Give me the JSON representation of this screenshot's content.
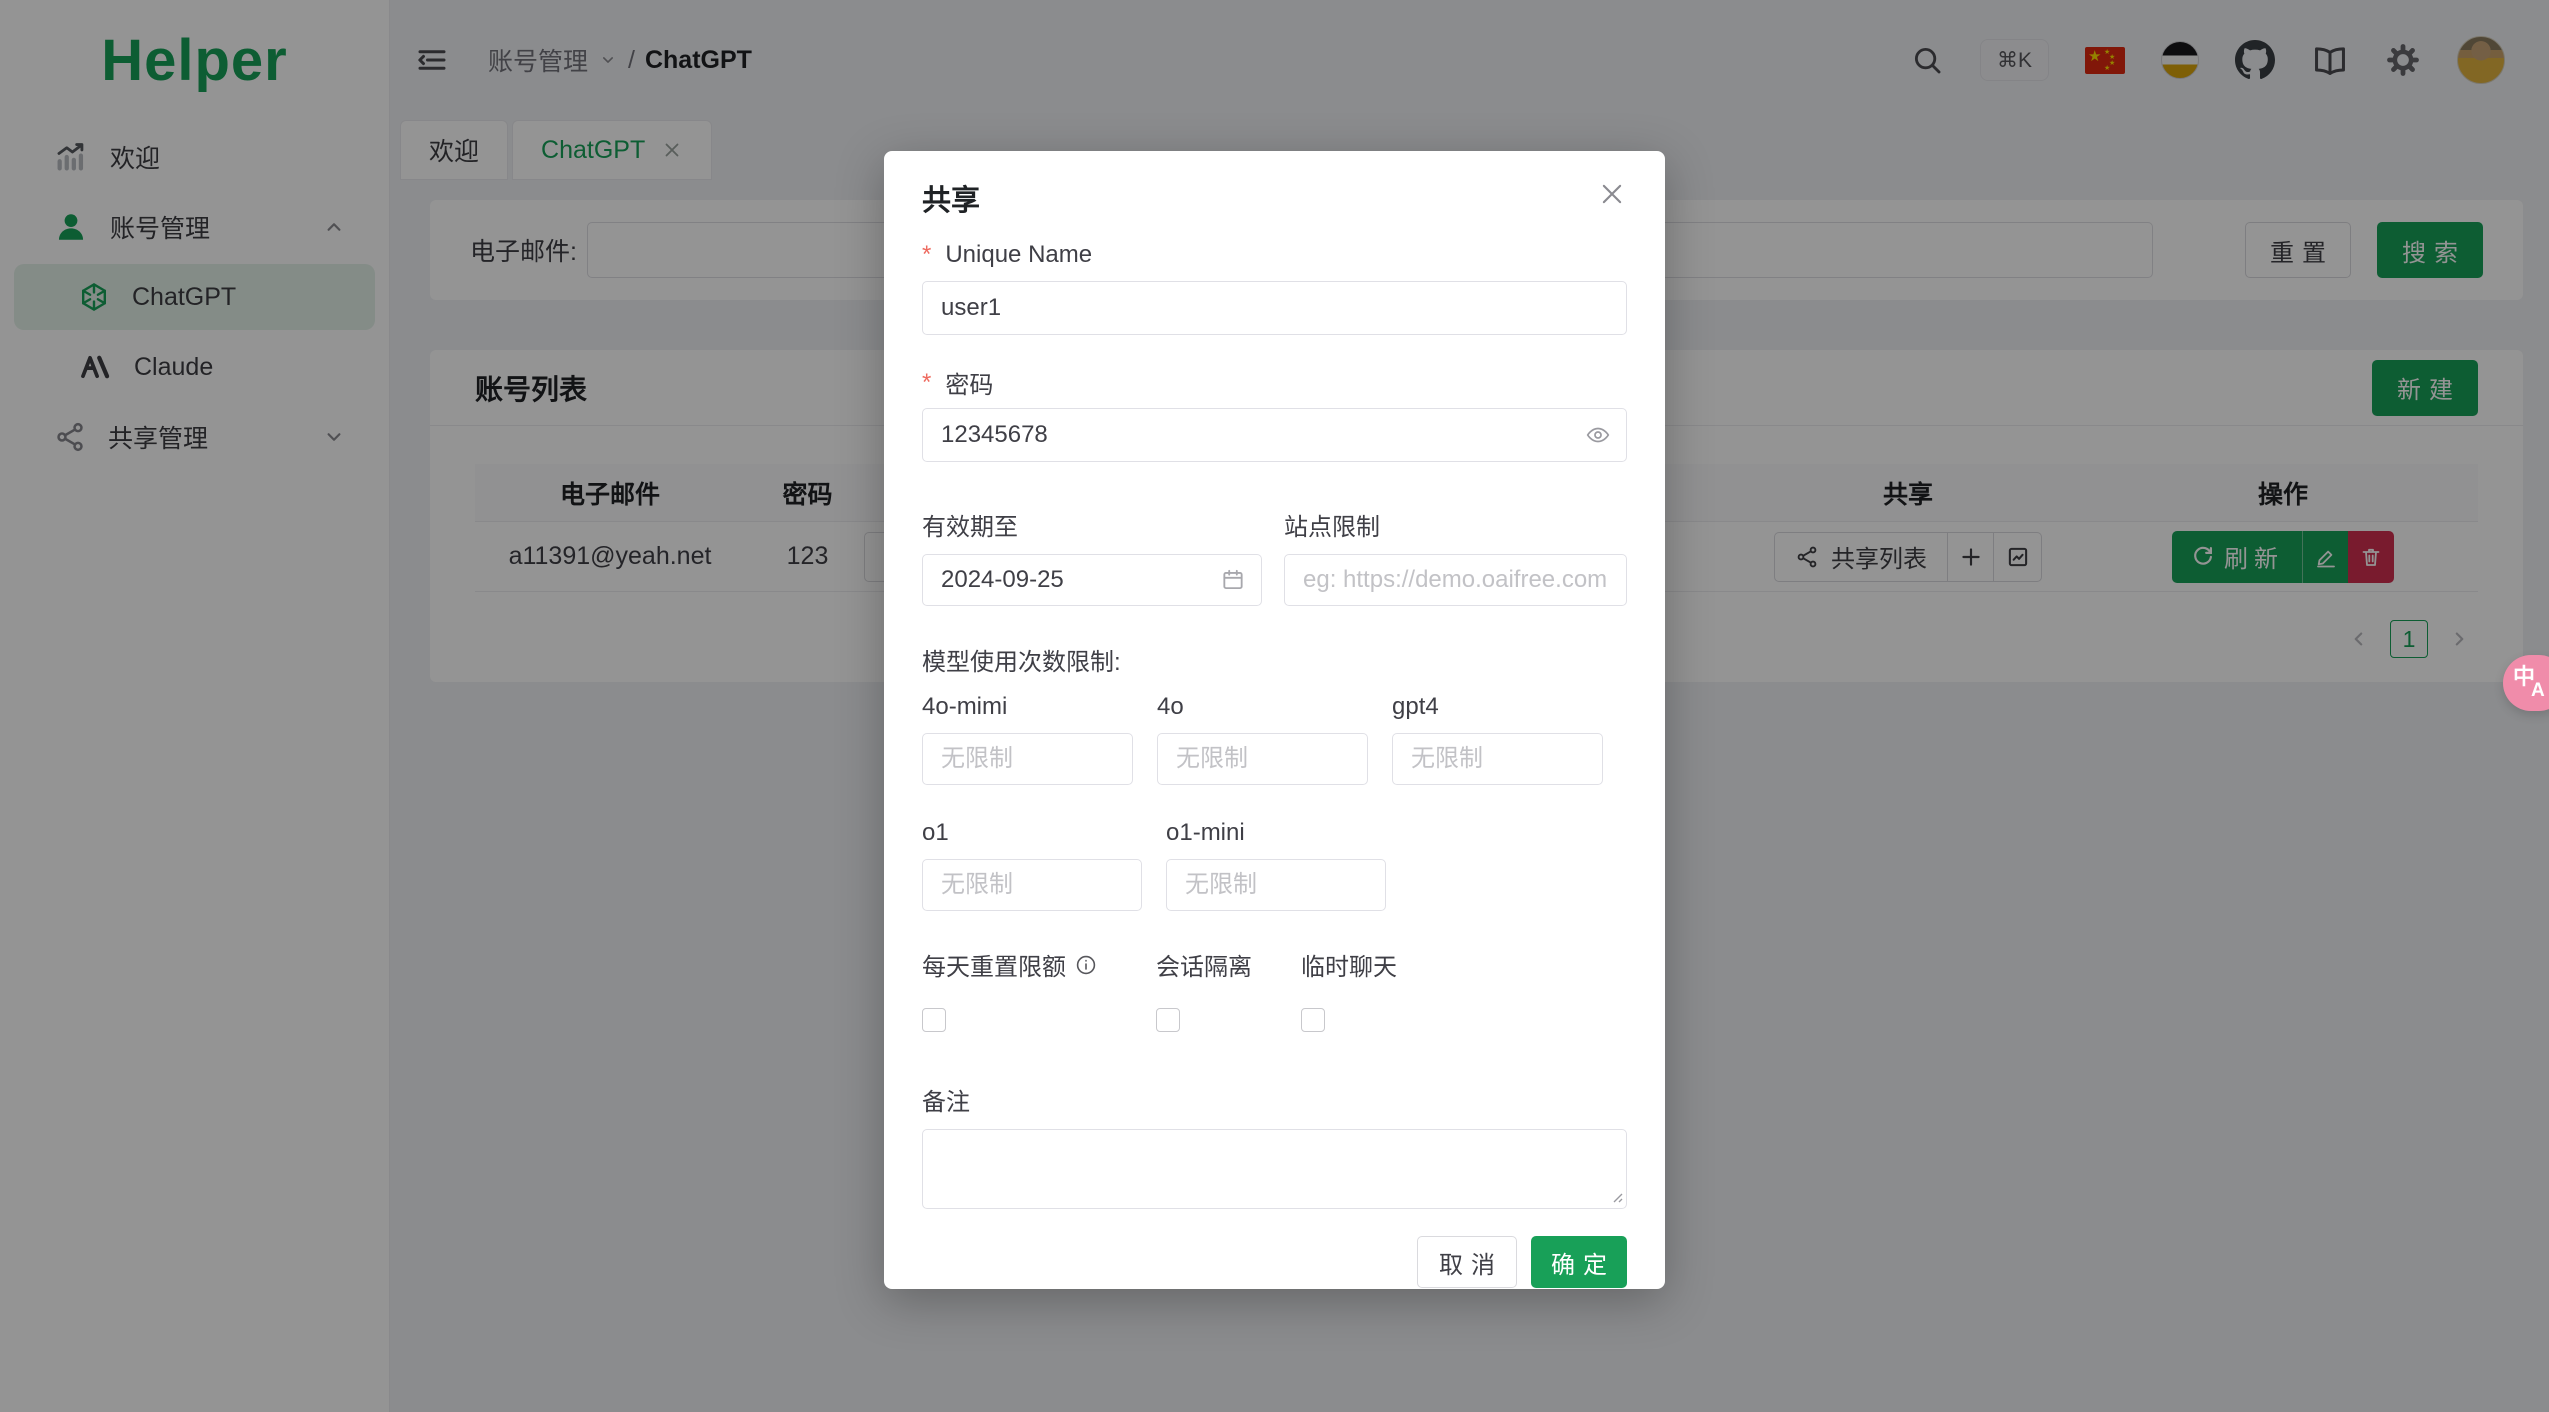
{
  "app": {
    "logo": "Helper"
  },
  "sidebar": {
    "items": [
      {
        "label": "欢迎",
        "icon": "trending-chart"
      },
      {
        "label": "账号管理",
        "icon": "person",
        "expanded": true
      },
      {
        "label": "ChatGPT",
        "icon": "openai",
        "selected": true
      },
      {
        "label": "Claude",
        "icon": "anthropic"
      },
      {
        "label": "共享管理",
        "icon": "share-nodes",
        "expanded": false
      }
    ]
  },
  "header": {
    "breadcrumb": {
      "parent": "账号管理",
      "separator": "/",
      "current": "ChatGPT"
    },
    "shortcut": "⌘K",
    "icons": [
      "search",
      "shortcut-badge",
      "flag-cn",
      "theme-ball",
      "github",
      "docs-book",
      "settings-gear",
      "avatar"
    ]
  },
  "tabs": [
    {
      "label": "欢迎"
    },
    {
      "label": "ChatGPT",
      "closable": true,
      "active": true
    }
  ],
  "filter": {
    "email_label": "电子邮件:",
    "reset": "重置",
    "search": "搜索"
  },
  "accounts": {
    "title": "账号列表",
    "new_button": "新建",
    "columns": [
      "电子邮件",
      "密码",
      "共享",
      "操作"
    ],
    "rows": [
      {
        "email": "a11391@yeah.net",
        "password": "123"
      }
    ],
    "share_list_button": "共享列表",
    "refresh_button": "刷新",
    "pagination": {
      "current": "1"
    }
  },
  "modal": {
    "title": "共享",
    "fields": {
      "unique_name": {
        "label": "Unique Name",
        "value": "user1",
        "required": true
      },
      "password": {
        "label": "密码",
        "value": "12345678",
        "required": true
      },
      "valid_until": {
        "label": "有效期至",
        "value": "2024-09-25"
      },
      "site_limit": {
        "label": "站点限制",
        "placeholder": "eg: https://demo.oaifree.com"
      }
    },
    "model_limits_label": "模型使用次数限制:",
    "models": [
      {
        "name": "4o-mimi",
        "placeholder": "无限制"
      },
      {
        "name": "4o",
        "placeholder": "无限制"
      },
      {
        "name": "gpt4",
        "placeholder": "无限制"
      },
      {
        "name": "o1",
        "placeholder": "无限制"
      },
      {
        "name": "o1-mini",
        "placeholder": "无限制"
      }
    ],
    "checkboxes": [
      {
        "label": "每天重置限额",
        "info": true,
        "checked": false
      },
      {
        "label": "会话隔离",
        "checked": false
      },
      {
        "label": "临时聊天",
        "checked": false
      }
    ],
    "remark_label": "备注",
    "cancel": "取消",
    "ok": "确定"
  },
  "colors": {
    "primary": "#18a058",
    "danger": "#d03050"
  }
}
